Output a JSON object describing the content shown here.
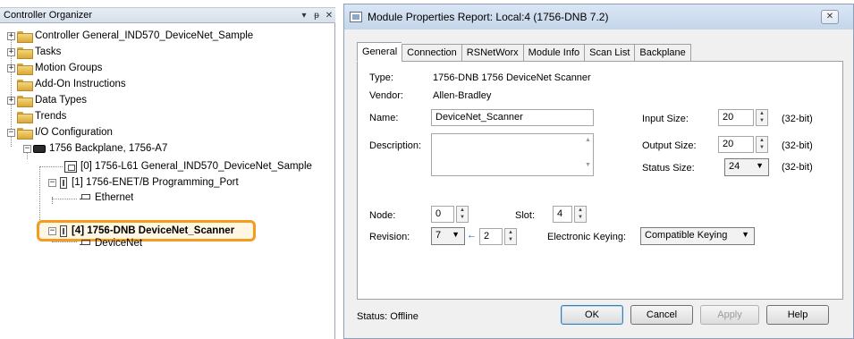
{
  "organizer": {
    "title": "Controller Organizer",
    "pin_glyph": "▾ ᵽ",
    "close_glyph": "✕",
    "tree": [
      {
        "label": "Controller General_IND570_DeviceNet_Sample",
        "icon": "folder-icon",
        "expander": "+"
      },
      {
        "label": "Tasks",
        "icon": "folder-icon",
        "expander": "+"
      },
      {
        "label": "Motion Groups",
        "icon": "folder-icon",
        "expander": "+"
      },
      {
        "label": "Add-On Instructions",
        "icon": "folder-icon",
        "expander": ""
      },
      {
        "label": "Data Types",
        "icon": "folder-icon",
        "expander": "+"
      },
      {
        "label": "Trends",
        "icon": "folder-icon",
        "expander": ""
      },
      {
        "label": "I/O Configuration",
        "icon": "folder-open-icon",
        "expander": "−"
      },
      {
        "label": "1756 Backplane, 1756-A7",
        "icon": "backplane-icon",
        "expander": "−"
      },
      {
        "label": "[0] 1756-L61 General_IND570_DeviceNet_Sample",
        "icon": "controller-icon",
        "expander": ""
      },
      {
        "label": "[1] 1756-ENET/B Programming_Port",
        "icon": "module-icon",
        "expander": "−"
      },
      {
        "label": "Ethernet",
        "icon": "network-icon",
        "expander": ""
      },
      {
        "label": "[4] 1756-DNB DeviceNet_Scanner",
        "icon": "module-icon",
        "expander": "−",
        "highlighted": true
      },
      {
        "label": "DeviceNet",
        "icon": "network-icon",
        "expander": ""
      }
    ]
  },
  "dialog": {
    "title": "Module Properties Report: Local:4 (1756-DNB 7.2)",
    "close_glyph": "☒",
    "tabs": [
      "General",
      "Connection",
      "RSNetWorx",
      "Module Info",
      "Scan List",
      "Backplane"
    ],
    "active_tab": "General",
    "general": {
      "type_label": "Type:",
      "type_value": "1756-DNB 1756 DeviceNet Scanner",
      "vendor_label": "Vendor:",
      "vendor_value": "Allen-Bradley",
      "name_label": "Name:",
      "name_value": "DeviceNet_Scanner",
      "description_label": "Description:",
      "description_value": "",
      "input_size_label": "Input Size:",
      "input_size_value": "20",
      "input_size_unit": "(32-bit)",
      "output_size_label": "Output Size:",
      "output_size_value": "20",
      "output_size_unit": "(32-bit)",
      "status_size_label": "Status Size:",
      "status_size_value": "24",
      "status_size_unit": "(32-bit)",
      "node_label": "Node:",
      "node_value": "0",
      "slot_label": "Slot:",
      "slot_value": "4",
      "revision_label": "Revision:",
      "revision_major": "7",
      "revision_minor": "2",
      "revision_arrow": "←",
      "keying_label": "Electronic Keying:",
      "keying_value": "Compatible Keying"
    },
    "status_text": "Status:  Offline",
    "buttons": {
      "ok": "OK",
      "cancel": "Cancel",
      "apply": "Apply",
      "help": "Help"
    }
  }
}
